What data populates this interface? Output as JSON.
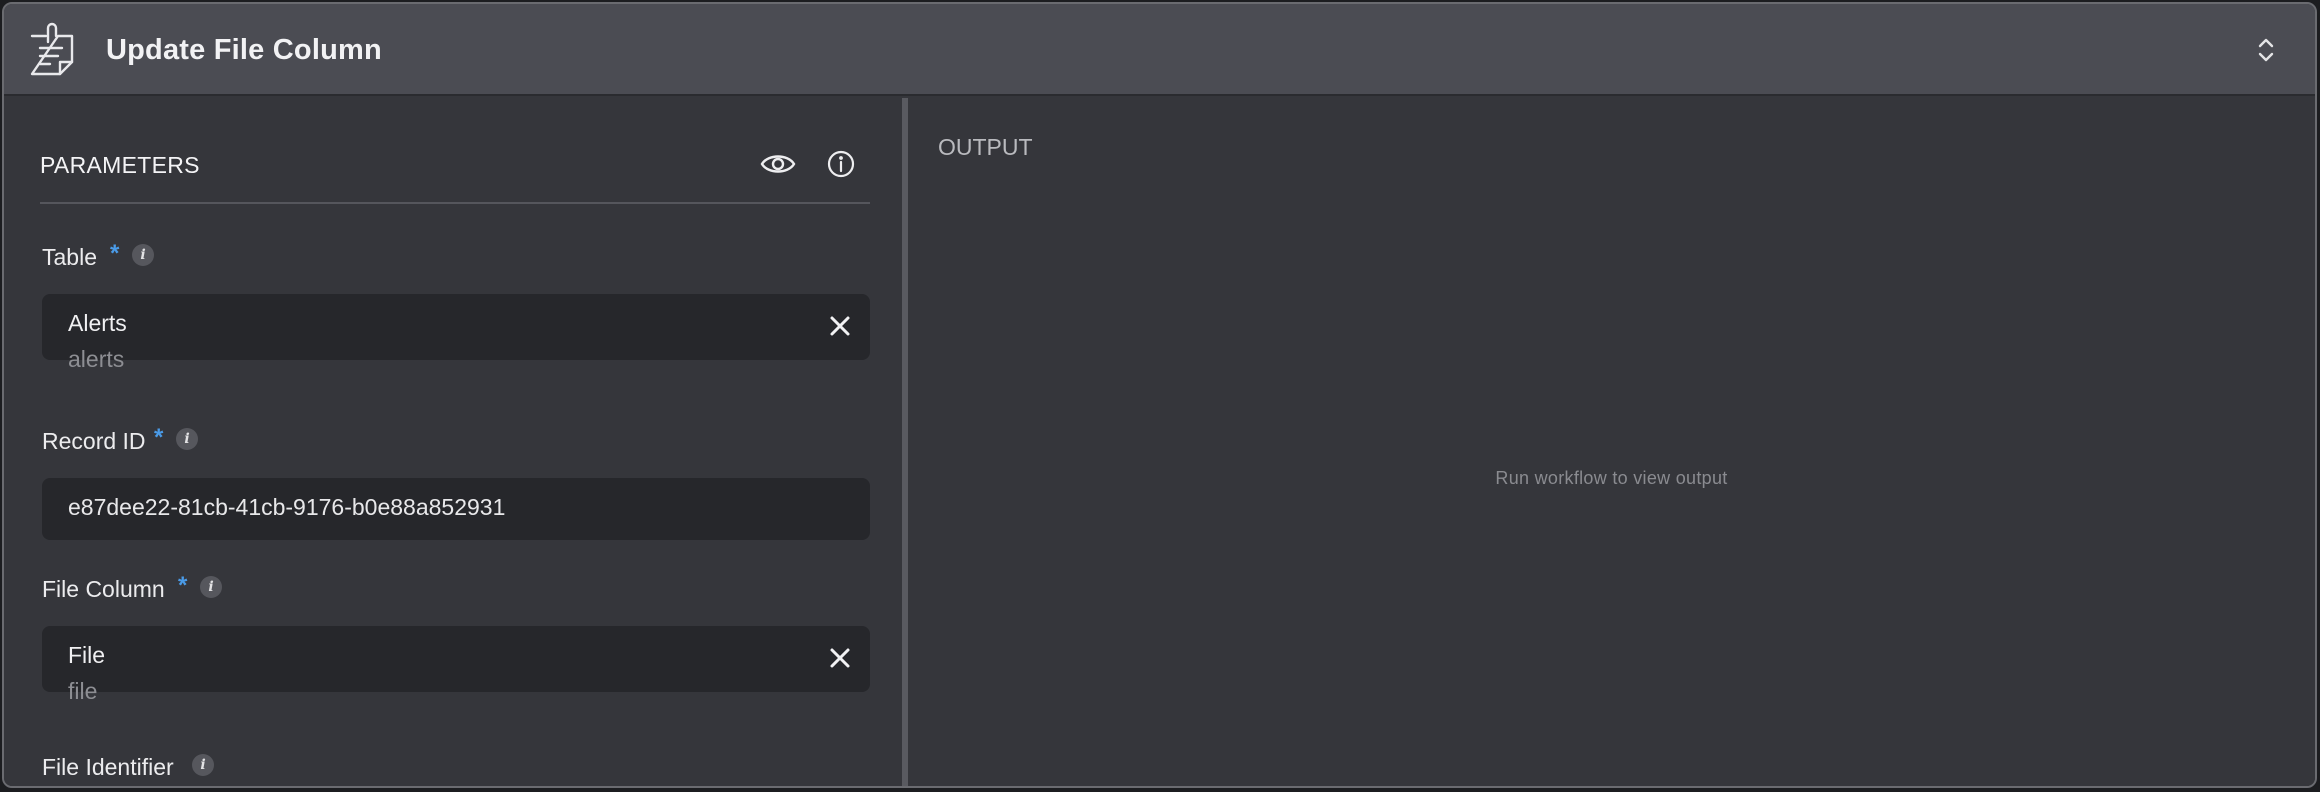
{
  "header": {
    "title": "Update File Column",
    "icon": "note-icon",
    "expand_icon": "chevron-up-down-icon"
  },
  "parameters": {
    "title": "PARAMETERS",
    "preview_icon": "eye-icon",
    "info_icon": "info-icon"
  },
  "fields": {
    "table": {
      "label": "Table",
      "required_mark": "*",
      "info_glyph": "i",
      "value_label": "Alerts",
      "value_key": "alerts"
    },
    "record_id": {
      "label": "Record ID",
      "required_mark": "*",
      "info_glyph": "i",
      "value": "e87dee22-81cb-41cb-9176-b0e88a852931"
    },
    "file_column": {
      "label": "File Column",
      "required_mark": "*",
      "info_glyph": "i",
      "value_label": "File",
      "value_key": "file"
    },
    "file_identifier": {
      "label": "File Identifier",
      "info_glyph": "i"
    }
  },
  "output": {
    "title": "OUTPUT",
    "empty_message": "Run workflow to view output"
  },
  "colors": {
    "accent_required": "#4a9be8",
    "header_bg": "#4b4c53",
    "panel_bg": "#35363b",
    "field_bg": "#26272b"
  }
}
